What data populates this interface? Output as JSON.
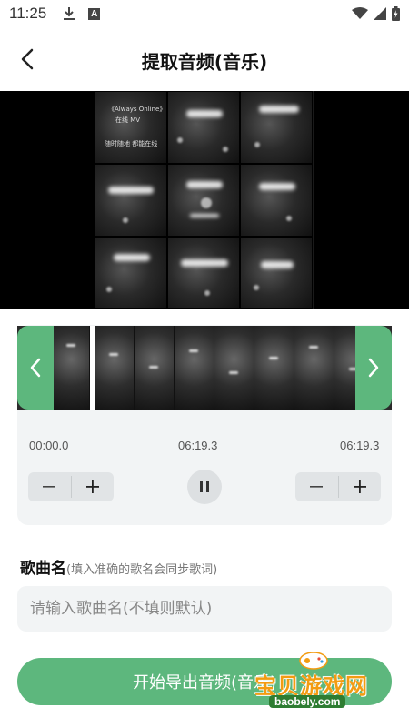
{
  "status_bar": {
    "time": "11:25"
  },
  "header": {
    "title": "提取音频(音乐)"
  },
  "timeline": {
    "start_time": "00:00.0",
    "current_time": "06:19.3",
    "end_time": "06:19.3"
  },
  "song": {
    "label": "歌曲名",
    "hint": "(填入准确的歌名会同步歌词)",
    "placeholder": "请输入歌曲名(不填则默认)"
  },
  "export_button": {
    "label": "开始导出音频(音乐)"
  },
  "video": {
    "title_text_1": "《Always Online》",
    "title_text_2": "在线 MV",
    "title_text_3": "随时随地 都能在线"
  },
  "watermark": {
    "text": "宝贝游戏网",
    "url": "baobely.com"
  },
  "colors": {
    "accent": "#5db77d",
    "card_bg": "#f2f4f5",
    "watermark_orange": "#f39c12"
  },
  "icons": {
    "back": "chevron-left-icon",
    "download": "download-icon",
    "wifi": "wifi-icon",
    "battery": "battery-icon",
    "pause": "pause-icon"
  }
}
